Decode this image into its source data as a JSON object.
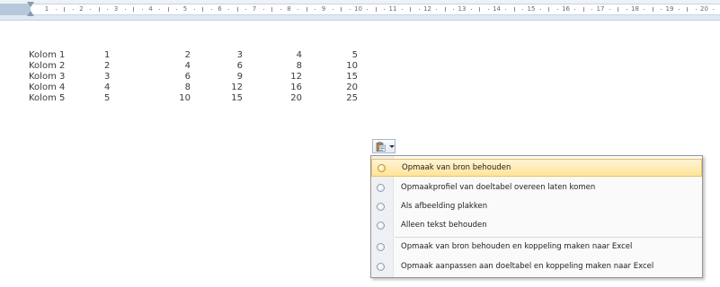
{
  "ruler": {
    "numbers": [
      "1",
      "2",
      "3",
      "4",
      "5",
      "6",
      "7",
      "8",
      "9",
      "10",
      "11",
      "12",
      "13",
      "14",
      "15",
      "16",
      "17",
      "18",
      "19",
      "20"
    ]
  },
  "table": {
    "rows": [
      {
        "label": "Kolom 1",
        "values": [
          "1",
          "2",
          "3",
          "4",
          "5"
        ]
      },
      {
        "label": "Kolom 2",
        "values": [
          "2",
          "4",
          "6",
          "8",
          "10"
        ]
      },
      {
        "label": "Kolom 3",
        "values": [
          "3",
          "6",
          "9",
          "12",
          "15"
        ]
      },
      {
        "label": "Kolom 4",
        "values": [
          "4",
          "8",
          "12",
          "16",
          "20"
        ]
      },
      {
        "label": "Kolom 5",
        "values": [
          "5",
          "10",
          "15",
          "20",
          "25"
        ]
      }
    ]
  },
  "paste_options": {
    "icon": "clipboard-icon"
  },
  "menu": {
    "items": [
      {
        "label": "Opmaak van bron behouden",
        "highlighted": true
      },
      {
        "label": "Opmaakprofiel van doeltabel overeen laten komen",
        "highlighted": false
      },
      {
        "label": "Als afbeelding plakken",
        "highlighted": false
      },
      {
        "label": "Alleen tekst behouden",
        "highlighted": false
      },
      {
        "label": "Opmaak van bron behouden en koppeling maken naar Excel",
        "highlighted": false
      },
      {
        "label": "Opmaak aanpassen aan doeltabel en koppeling maken naar Excel",
        "highlighted": false
      }
    ]
  },
  "colors": {
    "highlight": "#ffe49a",
    "text": "#222222"
  }
}
